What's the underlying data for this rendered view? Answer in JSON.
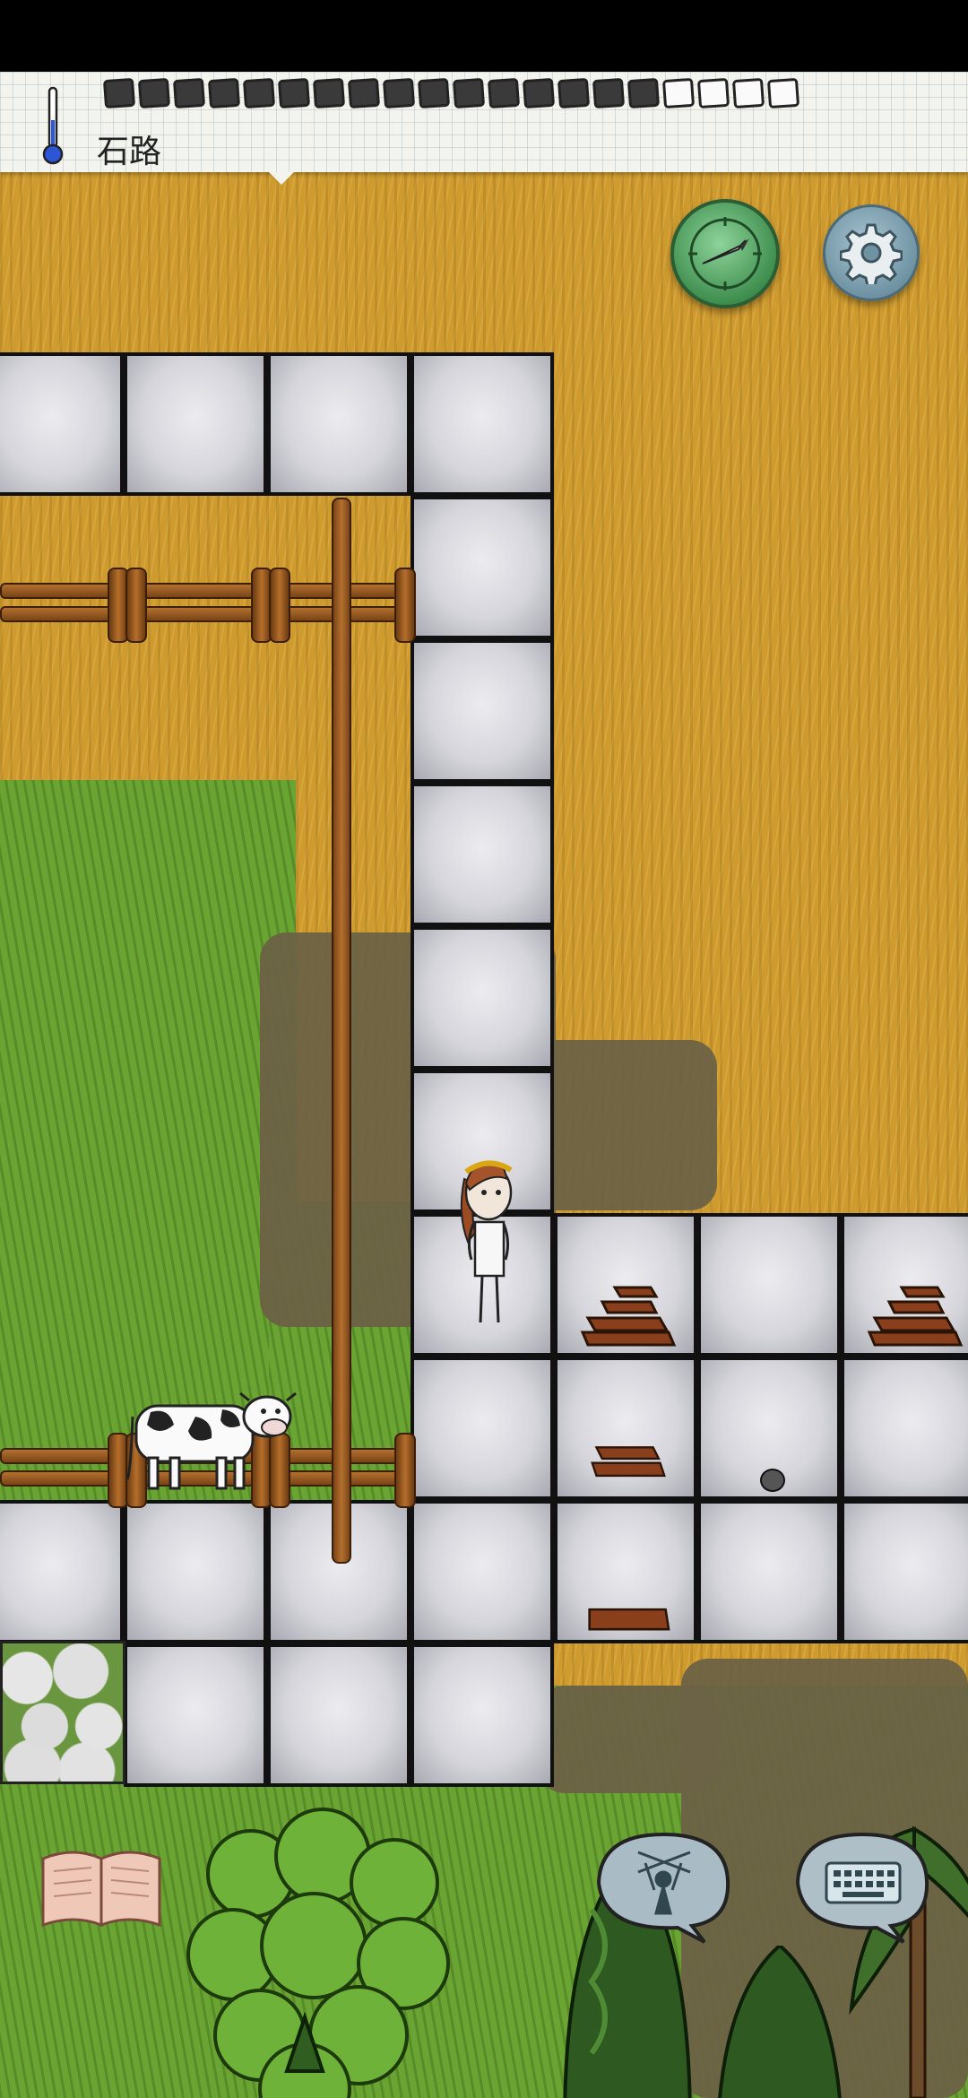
{
  "hud": {
    "location_label": "石路",
    "food_pips_filled": 16,
    "food_pips_total": 20
  },
  "icons": {
    "temperature": "thermometer-icon",
    "compass": "compass-icon",
    "settings": "gear-icon",
    "emote": "puppet-icon",
    "chat": "keyboard-icon",
    "journal": "book-icon"
  },
  "colors": {
    "dry_grass": "#cf9b2f",
    "green_grass": "#6aa432",
    "stone_tile": "#d5d5db",
    "compass_button": "#3f8f4f",
    "settings_button": "#6f93a3",
    "chat_bubble": "#aebfc7"
  }
}
